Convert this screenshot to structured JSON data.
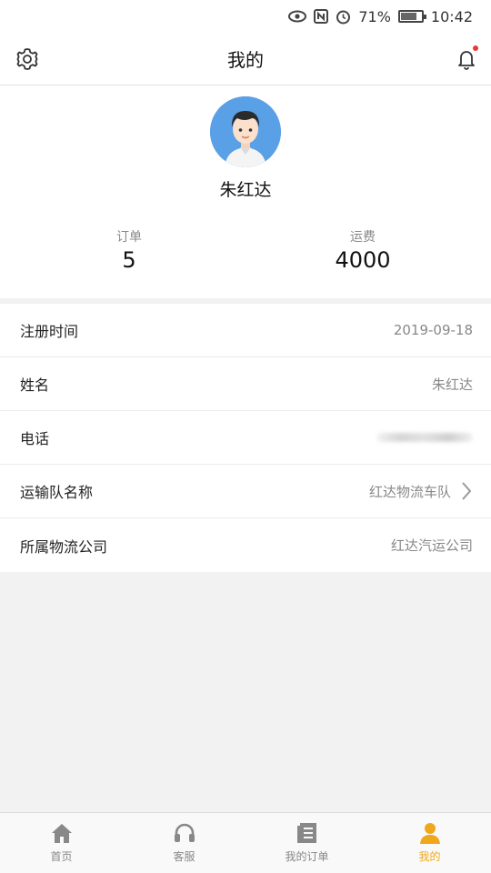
{
  "status_bar": {
    "battery": "71%",
    "time": "10:42",
    "icons": [
      "eye-icon",
      "nfc-icon",
      "alarm-icon",
      "battery-icon"
    ]
  },
  "header": {
    "title": "我的",
    "left_icon": "gear-icon",
    "right_icon": "bell-icon",
    "notification_dot_color": "#e53935"
  },
  "profile": {
    "avatar_icon": "user-avatar",
    "name": "朱红达",
    "stats": [
      {
        "label": "订单",
        "value": "5"
      },
      {
        "label": "运费",
        "value": "4000"
      }
    ]
  },
  "info": [
    {
      "key": "注册时间",
      "value": "2019-09-18"
    },
    {
      "key": "姓名",
      "value": "朱红达"
    },
    {
      "key": "电话",
      "value": ""
    },
    {
      "key": "运输队名称",
      "value": "红达物流车队"
    },
    {
      "key": "所属物流公司",
      "value": "红达汽运公司"
    }
  ],
  "tabs": [
    {
      "label": "首页",
      "icon": "home-icon"
    },
    {
      "label": "客服",
      "icon": "headset-icon"
    },
    {
      "label": "我的订单",
      "icon": "list-icon"
    },
    {
      "label": "我的",
      "icon": "person-icon"
    }
  ],
  "colors": {
    "accent": "#f0a81a",
    "avatar_bg": "#5aa0e6"
  }
}
